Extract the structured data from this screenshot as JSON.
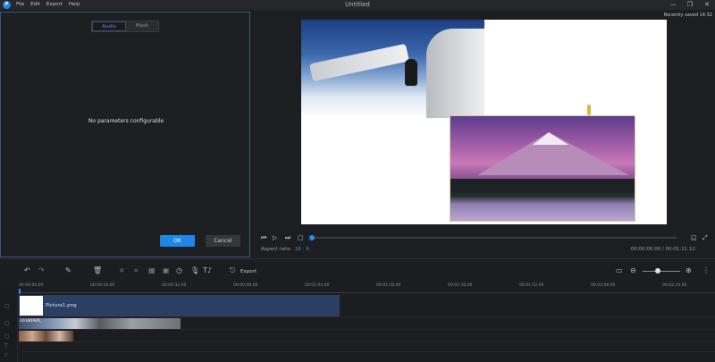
{
  "app": {
    "logo_text": "P",
    "title": "Untitled",
    "menu": [
      "File",
      "Edit",
      "Export",
      "Help"
    ],
    "window_controls": {
      "minimize": "—",
      "maximize": "❐",
      "close": "✕"
    }
  },
  "params_panel": {
    "tabs": [
      {
        "label": "Audio",
        "active": true
      },
      {
        "label": "Mask",
        "active": false
      }
    ],
    "message": "No parameters configurable",
    "ok_label": "OK",
    "cancel_label": "Cancel"
  },
  "preview": {
    "saved_note": "Recently saved 14:32",
    "aspect_label": "Aspect ratio",
    "aspect_value": "16 : 9",
    "timecode": "00:00:00.00 / 00:01:11.12",
    "progress_fraction": 0.0
  },
  "toolbar": {
    "export_label": "Export"
  },
  "ruler": {
    "labels": [
      "00:00:00.00",
      "00:00:16.00",
      "00:00:32.00",
      "00:00:48.00",
      "00:01:04.00",
      "00:01:20.00",
      "00:01:36.00",
      "00:01:52.00",
      "00:02:08.00",
      "00:02:24.00"
    ]
  },
  "timeline": {
    "image_clip_label": "Picture1.png",
    "video_clip_label": "20180926_"
  },
  "colors": {
    "accent": "#1e86e6",
    "panel_border": "#35588a"
  },
  "icons": [
    "undo-icon",
    "redo-icon",
    "pen-icon",
    "trash-icon",
    "crop-icon",
    "timer-icon",
    "mic-icon",
    "text-to-speech-icon",
    "export-icon",
    "zoom-out-icon",
    "zoom-in-icon"
  ]
}
